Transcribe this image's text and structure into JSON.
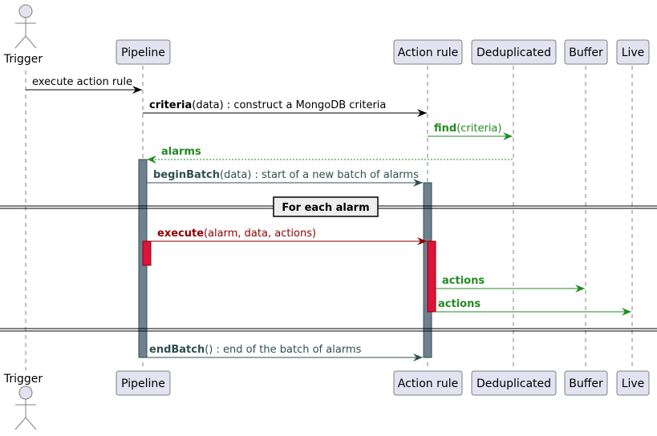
{
  "diagram": {
    "type": "sequence",
    "participants": [
      {
        "id": "trigger",
        "label": "Trigger",
        "kind": "actor"
      },
      {
        "id": "pipeline",
        "label": "Pipeline",
        "kind": "participant"
      },
      {
        "id": "actionrule",
        "label": "Action rule",
        "kind": "participant"
      },
      {
        "id": "dedup",
        "label": "Deduplicated",
        "kind": "participant"
      },
      {
        "id": "buffer",
        "label": "Buffer",
        "kind": "participant"
      },
      {
        "id": "live",
        "label": "Live",
        "kind": "participant"
      }
    ],
    "messages": [
      {
        "from": "trigger",
        "to": "pipeline",
        "bold": "",
        "text": "execute action rule",
        "color": "#000000",
        "style": "solid"
      },
      {
        "from": "pipeline",
        "to": "actionrule",
        "bold": "criteria",
        "text": "(data) : construct a MongoDB criteria",
        "color": "#000000",
        "style": "solid"
      },
      {
        "from": "actionrule",
        "to": "dedup",
        "bold": "find",
        "text": "(criteria)",
        "color": "#228B22",
        "style": "solid"
      },
      {
        "from": "dedup",
        "to": "pipeline",
        "bold": "alarms",
        "text": "",
        "color": "#228B22",
        "style": "dotted"
      },
      {
        "from": "pipeline",
        "to": "actionrule",
        "bold": "beginBatch",
        "text": "(data) : start of a new batch of alarms",
        "color": "#2F4F4F",
        "style": "solid"
      },
      {
        "from": "pipeline",
        "to": "actionrule",
        "bold": "execute",
        "text": "(alarm, data, actions)",
        "color": "#8B0000",
        "style": "solid"
      },
      {
        "from": "actionrule",
        "to": "buffer",
        "bold": "actions",
        "text": "",
        "color": "#228B22",
        "style": "solid"
      },
      {
        "from": "actionrule",
        "to": "live",
        "bold": "actions",
        "text": "",
        "color": "#228B22",
        "style": "solid"
      },
      {
        "from": "pipeline",
        "to": "actionrule",
        "bold": "endBatch",
        "text": "() : end of the batch of alarms",
        "color": "#2F4F4F",
        "style": "solid"
      }
    ],
    "divider": {
      "label": "For each alarm"
    },
    "colors": {
      "participant_fill": "#E2E2F0",
      "participant_border": "#808080",
      "lifeline": "#808080",
      "activation_gray": "#708090",
      "activation_red": "#DC143C"
    }
  }
}
